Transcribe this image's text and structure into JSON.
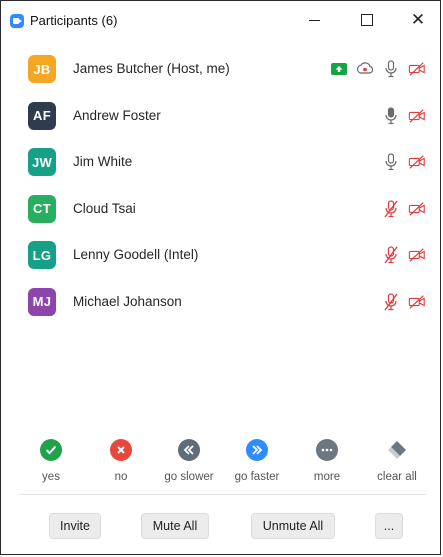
{
  "window": {
    "title": "Participants (6)",
    "close_glyph": "✕"
  },
  "participants": [
    {
      "initials": "JB",
      "name": "James Butcher (Host, me)",
      "avatar_color": "#f5a623",
      "icons": [
        "share-screen-icon",
        "record-icon",
        "microphone-icon",
        "video-off-icon"
      ]
    },
    {
      "initials": "AF",
      "name": "Andrew Foster",
      "avatar_color": "#2f3b4e",
      "icons": [
        "microphone-active-icon",
        "video-off-icon"
      ]
    },
    {
      "initials": "JW",
      "name": "Jim White",
      "avatar_color": "#16a085",
      "icons": [
        "microphone-icon",
        "video-off-icon"
      ]
    },
    {
      "initials": "CT",
      "name": "Cloud Tsai",
      "avatar_color": "#27ae60",
      "icons": [
        "microphone-muted-icon",
        "video-off-icon"
      ]
    },
    {
      "initials": "LG",
      "name": "Lenny Goodell (Intel)",
      "avatar_color": "#16a085",
      "icons": [
        "microphone-muted-icon",
        "video-off-icon"
      ]
    },
    {
      "initials": "MJ",
      "name": "Michael Johanson",
      "avatar_color": "#8e44ad",
      "icons": [
        "microphone-muted-icon",
        "video-off-icon"
      ]
    }
  ],
  "reactions": [
    {
      "label": "yes",
      "icon": "check-icon",
      "color": "#1fa34a"
    },
    {
      "label": "no",
      "icon": "x-icon",
      "color": "#e8473c"
    },
    {
      "label": "go slower",
      "icon": "rewind-icon",
      "color": "#5e6d7a"
    },
    {
      "label": "go faster",
      "icon": "fast-forward-icon",
      "color": "#2d8cff"
    },
    {
      "label": "more",
      "icon": "more-icon",
      "color": "#6d7782"
    },
    {
      "label": "clear all",
      "icon": "eraser-icon",
      "color": "#6d7782"
    }
  ],
  "footer": {
    "invite": "Invite",
    "mute_all": "Mute All",
    "unmute_all": "Unmute All",
    "more": "..."
  },
  "colors": {
    "share_green": "#11a642",
    "muted_red": "#e03a3a",
    "icon_gray": "#6b6b6b"
  }
}
